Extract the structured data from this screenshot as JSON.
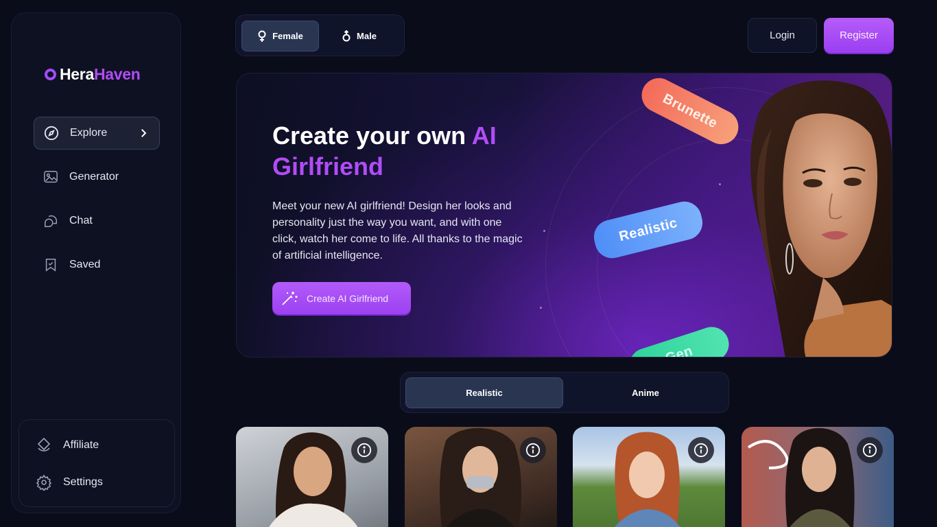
{
  "brand": {
    "name_part1": "Hera",
    "name_part2": "Haven"
  },
  "sidebar": {
    "nav": [
      {
        "label": "Explore",
        "icon": "compass-icon",
        "active": true
      },
      {
        "label": "Generator",
        "icon": "image-gen-icon"
      },
      {
        "label": "Chat",
        "icon": "chat-bubbles-icon"
      },
      {
        "label": "Saved",
        "icon": "bookmark-check-icon"
      }
    ],
    "bottom": [
      {
        "label": "Affiliate",
        "icon": "affiliate-icon"
      },
      {
        "label": "Settings",
        "icon": "gear-icon"
      }
    ]
  },
  "header": {
    "gender": [
      {
        "label": "Female",
        "icon": "female-symbol-icon",
        "selected": true
      },
      {
        "label": "Male",
        "icon": "male-symbol-icon",
        "selected": false
      }
    ],
    "login_label": "Login",
    "register_label": "Register"
  },
  "hero": {
    "title_plain": "Create your own ",
    "title_accent": "AI Girlfriend",
    "description": "Meet your new AI girlfriend! Design her looks and personality just the way you want, and with one click, watch her come to life. All thanks to the magic of artificial intelligence.",
    "cta_label": "Create AI Girlfriend",
    "tags": [
      "Brunette",
      "Realistic",
      "Gen"
    ]
  },
  "style_tabs": [
    {
      "label": "Realistic",
      "selected": true
    },
    {
      "label": "Anime",
      "selected": false
    }
  ],
  "colors": {
    "accent": "#b14cf7",
    "background": "#0a0c1a",
    "panel": "#10142a",
    "selected_tab": "#2a3552"
  }
}
